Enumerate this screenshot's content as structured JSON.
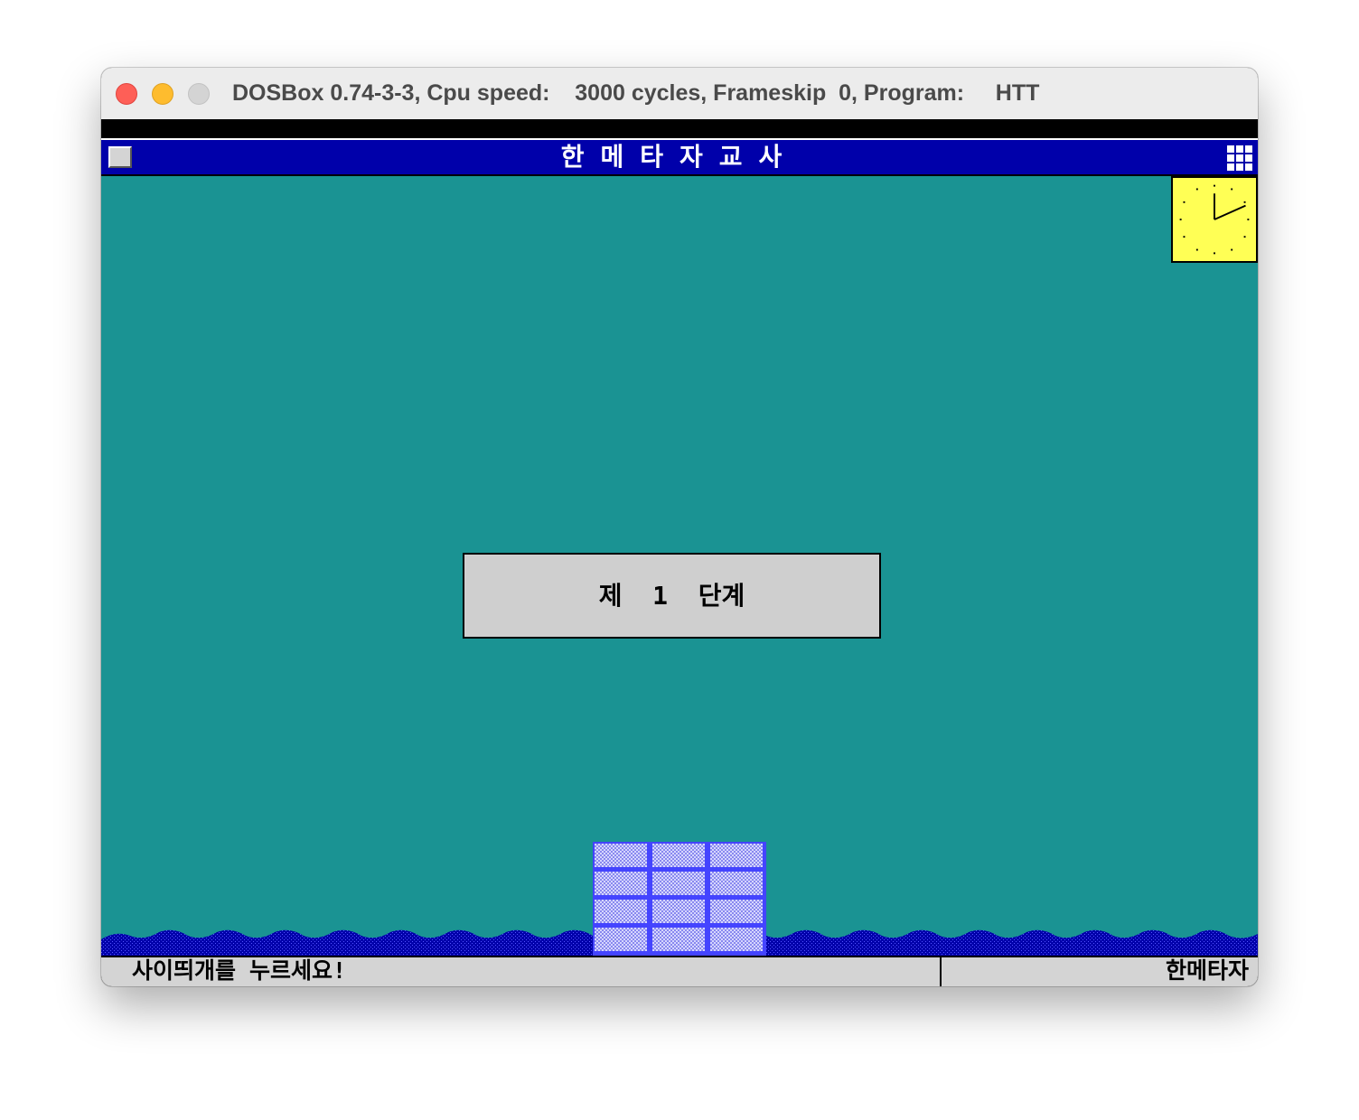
{
  "window": {
    "title": "DOSBox 0.74-3-3, Cpu speed:    3000 cycles, Frameskip  0, Program:     HTT"
  },
  "app": {
    "title": "한메타자교사"
  },
  "stage": {
    "text": "제  1  단계"
  },
  "statusbar": {
    "prompt": "사이띄개를 누르세요!",
    "app_name": "한메타자"
  },
  "icons": {
    "system_menu": "system-menu-icon",
    "menu_grid": "grid-icon",
    "clock": "clock-icon"
  },
  "colors": {
    "desktop": "#1a9393",
    "titlebar": "#0000aa",
    "clock_face": "#ffff55",
    "water": "#0000aa",
    "brick_mortar": "#4444ff"
  }
}
